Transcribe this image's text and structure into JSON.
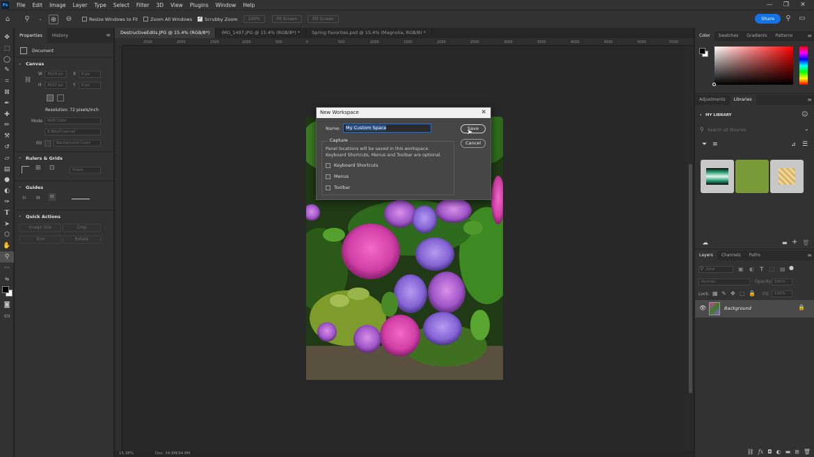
{
  "app": {
    "logo_text": "Ps"
  },
  "menu": [
    "File",
    "Edit",
    "Image",
    "Layer",
    "Type",
    "Select",
    "Filter",
    "3D",
    "View",
    "Plugins",
    "Window",
    "Help"
  ],
  "window_controls": {
    "minimize": "—",
    "restore": "❐",
    "close": "✕"
  },
  "options_bar": {
    "resize_windows": "Resize Windows to Fit",
    "zoom_all": "Zoom All Windows",
    "scrubby_zoom": "Scrubby Zoom",
    "zoom_value": "100%",
    "fit_screen": "Fit Screen",
    "fill_screen": "Fill Screen",
    "share": "Share"
  },
  "properties": {
    "tabs": [
      "Properties",
      "History"
    ],
    "document_label": "Document",
    "canvas_title": "Canvas",
    "w_label": "W",
    "w_value": "3024 px",
    "h_label": "H",
    "h_value": "4032 px",
    "x_label": "X",
    "x_value": "0 px",
    "y_label": "Y",
    "y_value": "0 px",
    "resolution": "Resolution: 72 pixels/inch",
    "mode_label": "Mode",
    "mode_value": "RGB Color",
    "depth_value": "8 Bits/Channel",
    "fill_label": "Fill",
    "fill_value": "Background Color",
    "rulers_title": "Rulers & Grids",
    "units_value": "Pixels",
    "guides_title": "Guides",
    "quick_actions_title": "Quick Actions",
    "btn_image_size": "Image Size",
    "btn_crop": "Crop",
    "btn_trim": "Trim",
    "btn_rotate": "Rotate"
  },
  "doc_tabs": [
    "DestructiveEdits.JPG @ 15.4% (RGB/8*)",
    "IMG_1497.JPG @ 15.4% (RGB/8*) *",
    "Spring Favorites.psd @ 15.4% (Magnolia, RGB/8) *"
  ],
  "ruler_marks": [
    "2500",
    "2000",
    "1500",
    "1000",
    "500",
    "0",
    "500",
    "1000",
    "1500",
    "2000",
    "2500",
    "3000",
    "3500",
    "4000",
    "4500",
    "5000",
    "5500"
  ],
  "status": {
    "zoom": "15.38%",
    "doc": "Doc: 34.9M/34.9M"
  },
  "dialog": {
    "title": "New Workspace",
    "name_label": "Name:",
    "name_value": "My Custom Space",
    "save": "Save",
    "cancel": "Cancel",
    "capture_title": "Capture",
    "capture_desc_1": "Panel locations will be saved in this workspace.",
    "capture_desc_2": "Keyboard Shortcuts, Menus and Toolbar are optional.",
    "opt_keyboard": "Keyboard Shortcuts",
    "opt_menus": "Menus",
    "opt_toolbar": "Toolbar"
  },
  "color_panel": {
    "tabs": [
      "Color",
      "Swatches",
      "Gradients",
      "Patterns"
    ]
  },
  "libraries": {
    "tabs": [
      "Adjustments",
      "Libraries"
    ],
    "title": "MY LIBRARY",
    "search_placeholder": "Search all libraries",
    "swatch_colors": [
      "#7a9a3a"
    ]
  },
  "layers": {
    "tabs": [
      "Layers",
      "Channels",
      "Paths"
    ],
    "kind": "Kind",
    "blend_mode": "Normal",
    "opacity_label": "Opacity:",
    "opacity_value": "100%",
    "lock_label": "Lock:",
    "fill_label": "Fill:",
    "fill_value": "100%",
    "layer_name": "Background"
  }
}
